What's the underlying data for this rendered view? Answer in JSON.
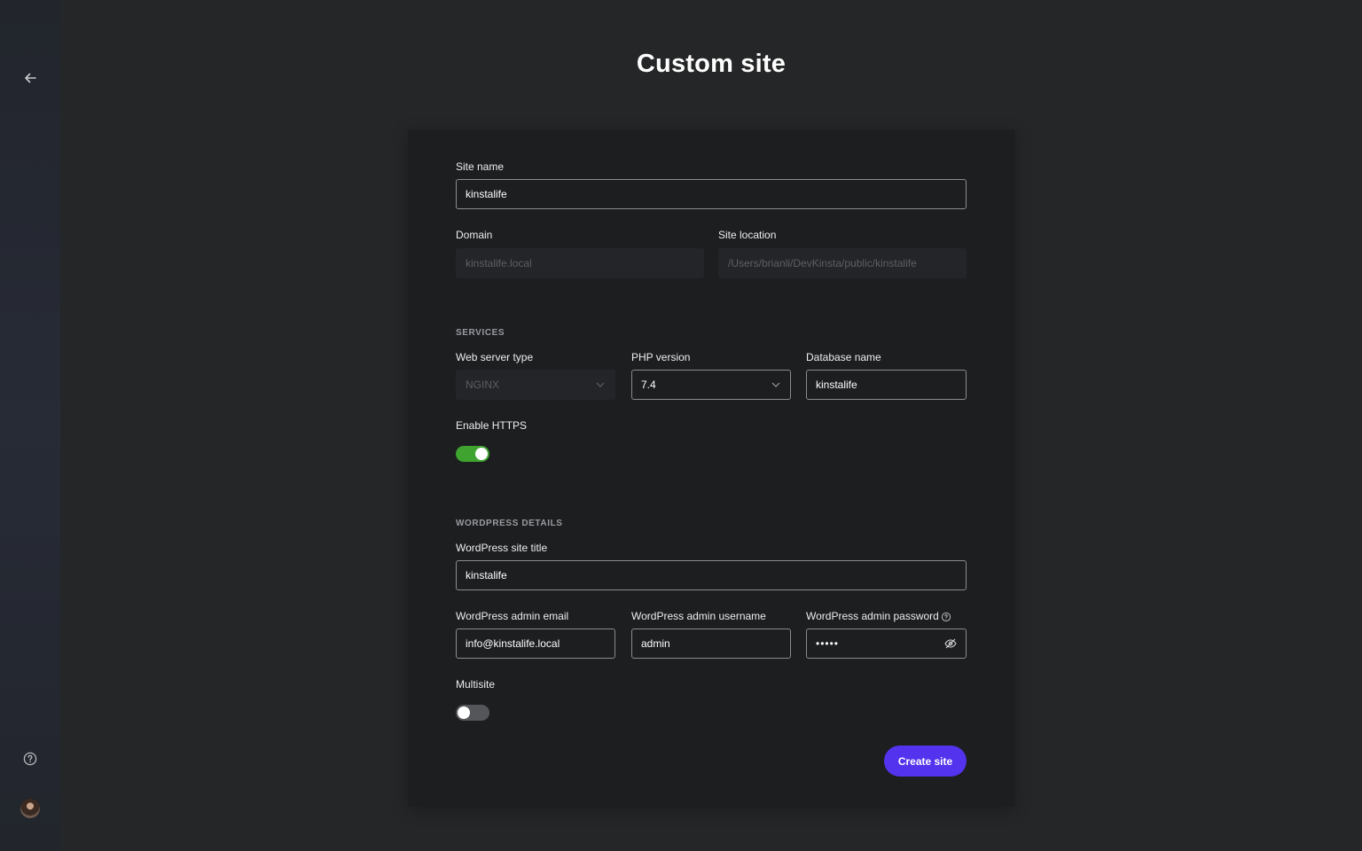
{
  "page": {
    "title": "Custom site"
  },
  "sidebar": {
    "back_icon": "arrow-left-icon",
    "help_icon": "question-circle-icon",
    "avatar": "user-avatar"
  },
  "form": {
    "site_name": {
      "label": "Site name",
      "value": "kinstalife"
    },
    "domain": {
      "label": "Domain",
      "value": "kinstalife.local"
    },
    "site_location": {
      "label": "Site location",
      "value": "/Users/brianli/DevKinsta/public/kinstalife"
    },
    "services": {
      "heading": "SERVICES",
      "web_server": {
        "label": "Web server type",
        "value": "NGINX"
      },
      "php_version": {
        "label": "PHP version",
        "value": "7.4"
      },
      "database_name": {
        "label": "Database name",
        "value": "kinstalife"
      },
      "https": {
        "label": "Enable HTTPS",
        "enabled": true
      }
    },
    "wordpress": {
      "heading": "WORDPRESS DETAILS",
      "site_title": {
        "label": "WordPress site title",
        "value": "kinstalife"
      },
      "admin_email": {
        "label": "WordPress admin email",
        "value": "info@kinstalife.local"
      },
      "admin_username": {
        "label": "WordPress admin username",
        "value": "admin"
      },
      "admin_password": {
        "label": "WordPress admin password",
        "value": "•••••"
      },
      "multisite": {
        "label": "Multisite",
        "enabled": false
      }
    },
    "submit_label": "Create site"
  },
  "colors": {
    "accent": "#5333ed",
    "toggle_on": "#3ea32f",
    "background": "#252627",
    "card": "#1d1e20"
  }
}
